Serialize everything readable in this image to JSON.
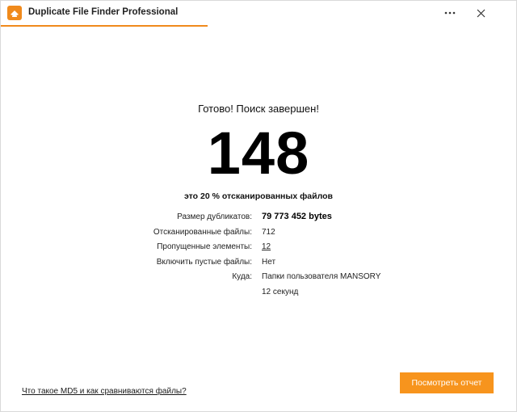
{
  "window": {
    "title": "Duplicate File Finder Professional",
    "accent_color": "#f08a1c",
    "controls": {
      "more_icon": "more-dots-icon",
      "close_icon": "close-icon"
    }
  },
  "result": {
    "heading": "Готово! Поиск завершен!",
    "duplicate_count": "148",
    "percent_text": "это 20 % отсканированных файлов"
  },
  "stats": [
    {
      "label": "Размер дубликатов:",
      "value": "79 773 452 bytes"
    },
    {
      "label": "Отсканированные файлы:",
      "value": "712"
    },
    {
      "label": "Пропущенные элементы:",
      "value": "12"
    },
    {
      "label": "Включить пустые файлы:",
      "value": "Нет"
    },
    {
      "label": "Куда:",
      "value": "Папки пользователя MANSORY"
    },
    {
      "label": "",
      "value": "12 секунд"
    }
  ],
  "footer": {
    "md5_link": "Что такое MD5 и как сравниваются файлы?",
    "report_button": "Посмотреть отчет",
    "button_color": "#f7941d"
  }
}
